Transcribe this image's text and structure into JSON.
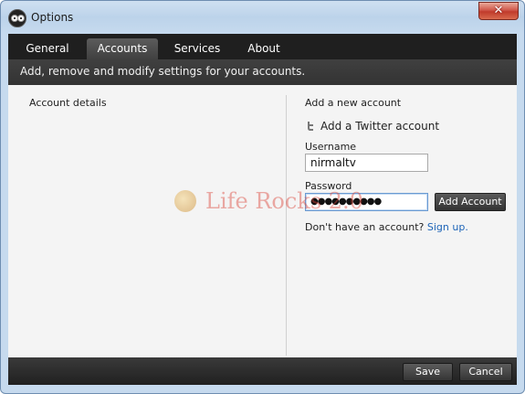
{
  "window": {
    "title": "Options",
    "close_glyph": "✕"
  },
  "tabs": [
    {
      "label": "General",
      "active": false
    },
    {
      "label": "Accounts",
      "active": true
    },
    {
      "label": "Services",
      "active": false
    },
    {
      "label": "About",
      "active": false
    }
  ],
  "subheader": "Add, remove and modify settings for your accounts.",
  "left_panel": {
    "title": "Account details"
  },
  "right_panel": {
    "title": "Add a new account",
    "service_icon": "twitter-icon",
    "service_label": "Add a Twitter account",
    "username_label": "Username",
    "username_value": "nirmaltv",
    "password_label": "Password",
    "password_value": "●●●●●●●●●●",
    "add_button": "Add Account",
    "signup_prompt": "Don't have an account?",
    "signup_link": "Sign up."
  },
  "watermark": "Life Rocks 2.0",
  "footer": {
    "save": "Save",
    "cancel": "Cancel"
  },
  "colors": {
    "link": "#1c63b7",
    "dark_bar": "#1f1f1f",
    "close_button": "#c03a2b"
  }
}
